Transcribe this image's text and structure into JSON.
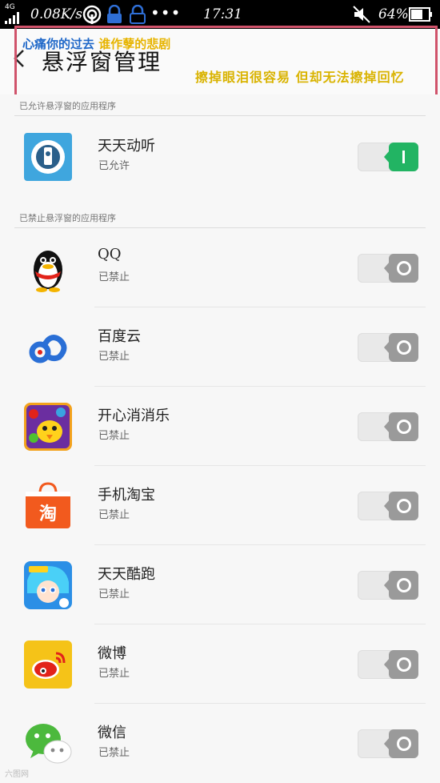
{
  "status_bar": {
    "network_type": "4G",
    "speed": "0.08K/s",
    "time": "17:31",
    "battery": "64%"
  },
  "header": {
    "title": "悬浮窗管理",
    "annotation_line1_a": "心痛你的过去",
    "annotation_line1_b": "谁作孽的悲剧",
    "annotation_line2": "擦掉眼泪很容易 但却无法擦掉回忆"
  },
  "sections": {
    "allowed_header": "已允许悬浮窗的应用程序",
    "blocked_header": "已禁止悬浮窗的应用程序"
  },
  "allowed_apps": [
    {
      "name": "天天动听",
      "status": "已允许",
      "enabled": true
    }
  ],
  "blocked_apps": [
    {
      "name": "QQ",
      "status": "已禁止",
      "enabled": false
    },
    {
      "name": "百度云",
      "status": "已禁止",
      "enabled": false
    },
    {
      "name": "开心消消乐",
      "status": "已禁止",
      "enabled": false
    },
    {
      "name": "手机淘宝",
      "status": "已禁止",
      "enabled": false
    },
    {
      "name": "天天酷跑",
      "status": "已禁止",
      "enabled": false
    },
    {
      "name": "微博",
      "status": "已禁止",
      "enabled": false
    },
    {
      "name": "微信",
      "status": "已禁止",
      "enabled": false
    }
  ],
  "colors": {
    "toggle_on": "#22b463",
    "toggle_off": "#9a9a9a",
    "annotation_border": "#d0536b"
  },
  "watermark": "六图网"
}
